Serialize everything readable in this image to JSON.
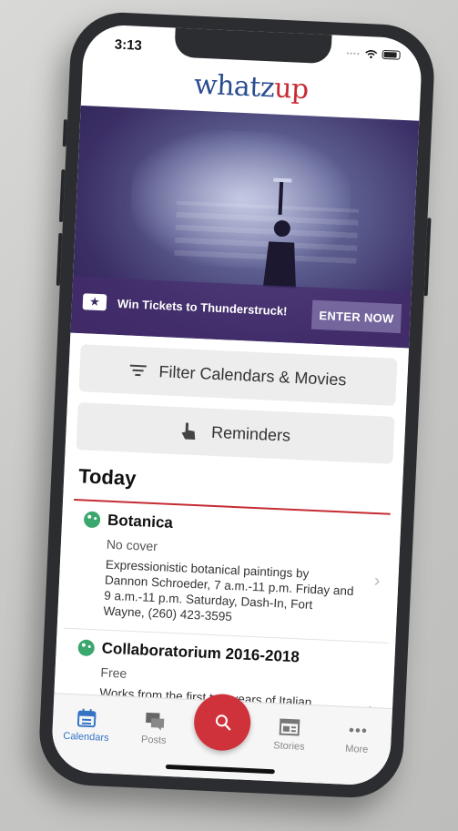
{
  "status": {
    "time": "3:13"
  },
  "brand": {
    "part1": "whatz",
    "part2": "up"
  },
  "banner": {
    "promo_text": "Win Tickets to Thunderstruck!",
    "cta_label": "ENTER NOW"
  },
  "actions": {
    "filter_label": "Filter Calendars & Movies",
    "reminders_label": "Reminders"
  },
  "section": {
    "title": "Today"
  },
  "events": [
    {
      "title": "Botanica",
      "price": "No cover",
      "description": "Expressionistic botanical paintings by Dannon Schroeder, 7 a.m.-11 p.m. Friday and 9 a.m.-11 p.m. Saturday, Dash-In, Fort Wayne, (260) 423-3595"
    },
    {
      "title": "Collaboratorium 2016-2018",
      "price": "Free",
      "description": "Works from the first two years of Italian"
    }
  ],
  "tabs": [
    {
      "label": "Calendars",
      "icon": "calendar-icon",
      "active": true
    },
    {
      "label": "Posts",
      "icon": "chat-icon"
    },
    {
      "label": "",
      "icon": "search-icon"
    },
    {
      "label": "Stories",
      "icon": "newspaper-icon"
    },
    {
      "label": "More",
      "icon": "more-icon"
    }
  ],
  "colors": {
    "brand_blue": "#2a4d8f",
    "brand_red": "#c62b34",
    "tab_active": "#3574c4",
    "category_green": "#3aa76d"
  }
}
